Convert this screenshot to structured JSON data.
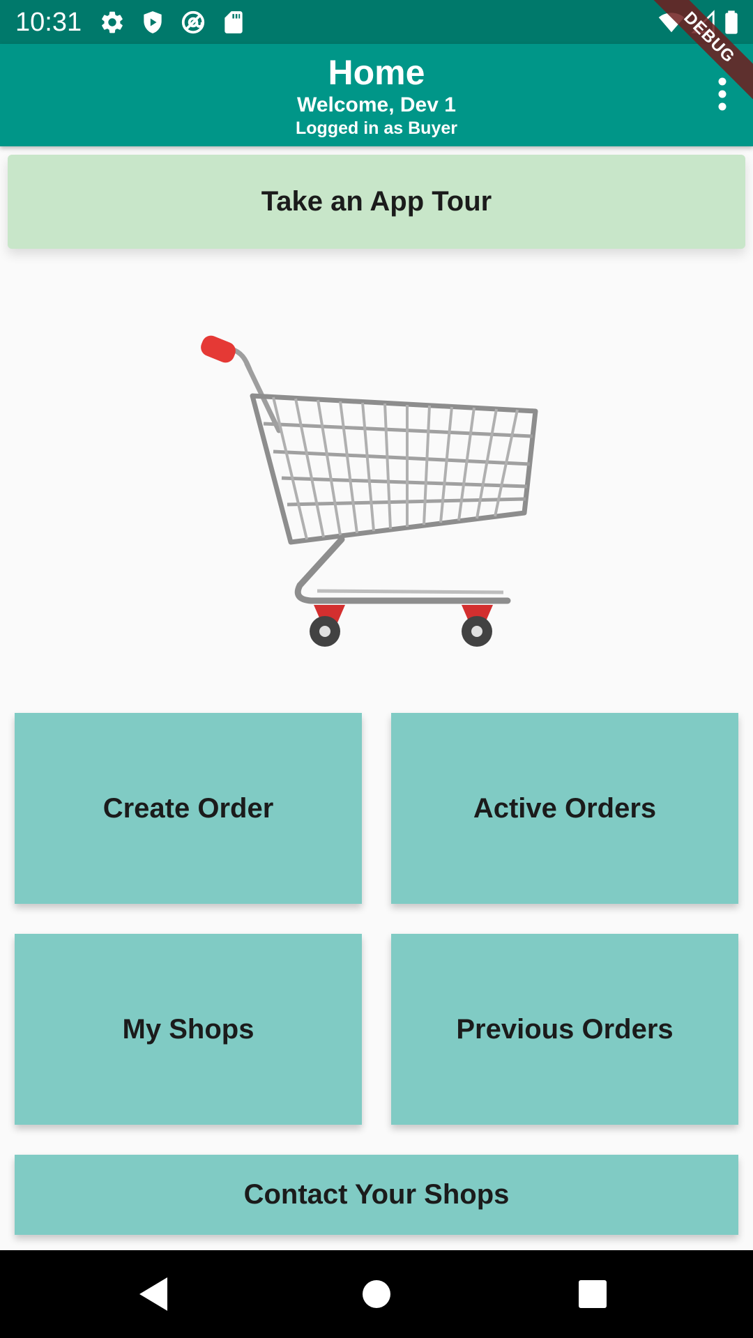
{
  "status_bar": {
    "time": "10:31",
    "icons": [
      "gear-icon",
      "shield-icon",
      "at-sign-icon",
      "sd-card-icon",
      "wifi-icon",
      "signal-icon",
      "battery-icon"
    ]
  },
  "app_bar": {
    "title": "Home",
    "subtitle": "Welcome, Dev 1",
    "caption": "Logged in as Buyer",
    "menu_icon": "more-vert-icon",
    "banner": "DEBUG"
  },
  "tour_button": {
    "label": "Take an App Tour"
  },
  "hero_image": {
    "icon": "shopping-cart-icon"
  },
  "tiles": {
    "create_order": "Create Order",
    "active_orders": "Active Orders",
    "my_shops": "My Shops",
    "previous_orders": "Previous Orders",
    "contact_shops": "Contact Your Shops"
  },
  "nav_bar": {
    "icons": [
      "back-icon",
      "home-icon",
      "recents-icon"
    ]
  },
  "colors": {
    "status_bar": "#00796b",
    "app_bar": "#009688",
    "tour_button": "#c8e6c9",
    "tile": "#80cbc4",
    "background": "#fafafa"
  }
}
